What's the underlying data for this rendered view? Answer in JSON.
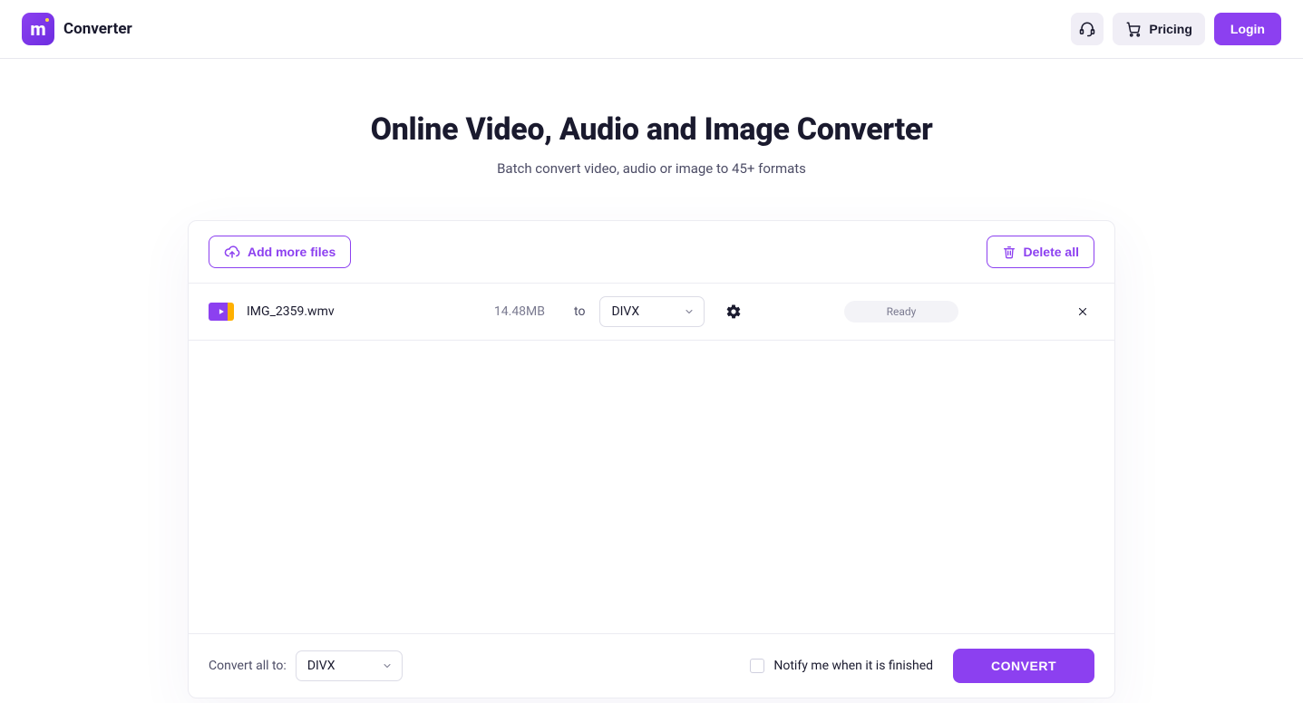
{
  "header": {
    "brand_name": "Converter",
    "pricing_label": "Pricing",
    "login_label": "Login"
  },
  "hero": {
    "title": "Online Video, Audio and Image Converter",
    "subtitle": "Batch convert video, audio or image to 45+ formats"
  },
  "panel": {
    "add_more_label": "Add more files",
    "delete_all_label": "Delete all"
  },
  "files": [
    {
      "name": "IMG_2359.wmv",
      "size": "14.48MB",
      "to_label": "to",
      "target_format": "DIVX",
      "status": "Ready"
    }
  ],
  "footer": {
    "convert_all_label": "Convert all to:",
    "convert_all_format": "DIVX",
    "notify_label": "Notify me when it is finished",
    "convert_button": "CONVERT"
  },
  "colors": {
    "accent": "#8c40f0"
  }
}
